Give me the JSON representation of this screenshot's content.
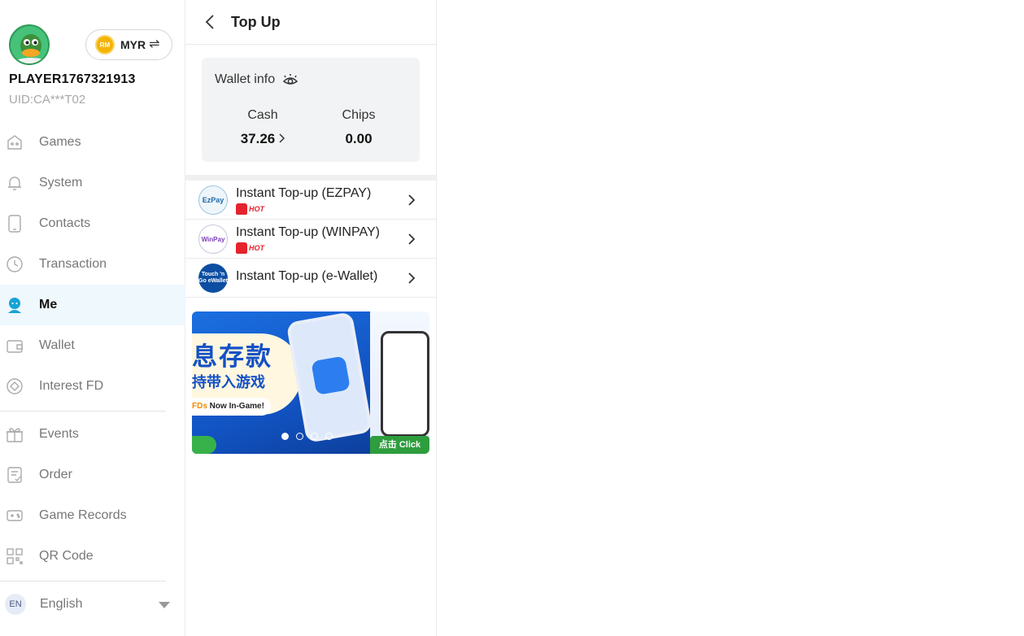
{
  "profile": {
    "player_name": "PLAYER1767321913",
    "uid": "UID:CA***T02",
    "currency_coin": "RM",
    "currency": "MYR",
    "swap_glyph": "⇌",
    "avatar_icon": "duck-avatar-icon"
  },
  "sidebar": {
    "items": [
      {
        "label": "Games",
        "icon": "gamepad-icon",
        "active": false
      },
      {
        "label": "System",
        "icon": "bell-icon",
        "active": false
      },
      {
        "label": "Contacts",
        "icon": "phone-icon",
        "active": false
      },
      {
        "label": "Transaction",
        "icon": "clock-icon",
        "active": false
      },
      {
        "label": "Me",
        "icon": "user-icon",
        "active": true
      },
      {
        "label": "Wallet",
        "icon": "wallet-icon",
        "active": false
      },
      {
        "label": "Interest FD",
        "icon": "diamond-icon",
        "active": false
      },
      {
        "label": "Events",
        "icon": "gift-icon",
        "active": false
      },
      {
        "label": "Order",
        "icon": "order-icon",
        "active": false
      },
      {
        "label": "Game Records",
        "icon": "controller-icon",
        "active": false
      },
      {
        "label": "QR Code",
        "icon": "qr-code-icon",
        "active": false
      }
    ],
    "language": {
      "badge": "EN",
      "label": "English"
    }
  },
  "panel": {
    "title": "Top Up",
    "wallet": {
      "title": "Wallet info",
      "cash_label": "Cash",
      "cash_value": "37.26",
      "chips_label": "Chips",
      "chips_value": "0.00"
    },
    "topup_methods": [
      {
        "label": "Instant Top-up (EZPAY)",
        "logo_text": "EzPay",
        "hot": true,
        "hot_text": "HOT"
      },
      {
        "label": "Instant Top-up (WINPAY)",
        "logo_text": "WinPay",
        "hot": true,
        "hot_text": "HOT"
      },
      {
        "label": "Instant Top-up (e-Wallet)",
        "logo_text": "Touch 'n Go eWallet",
        "hot": false
      }
    ],
    "banner": {
      "headline": "息存款",
      "subline": "持带入游戏",
      "tagline_accent": "FDs",
      "tagline": " Now In-Game!",
      "click_label": "点击 Click",
      "slide_count": 4,
      "active_slide": 1
    }
  },
  "colors": {
    "active_bg": "#eef8fd",
    "accent": "#16a3d6",
    "hot_red": "#e5232d",
    "banner_blue": "#1451c6"
  }
}
